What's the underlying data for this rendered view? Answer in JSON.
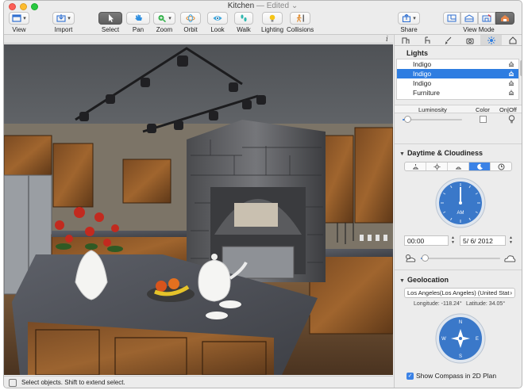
{
  "window": {
    "title": "Kitchen",
    "edited": " — Edited ⌄"
  },
  "toolbar": {
    "view": "View",
    "import": "Import",
    "select": "Select",
    "pan": "Pan",
    "zoom": "Zoom",
    "orbit": "Orbit",
    "look": "Look",
    "walk": "Walk",
    "lighting": "Lighting",
    "collisions": "Collisions",
    "share": "Share",
    "view_mode": "View Mode"
  },
  "status": {
    "text": "Select objects. Shift to extend select."
  },
  "panel": {
    "lights_title": "Lights",
    "lights": [
      {
        "name": "Indigo",
        "selected": false
      },
      {
        "name": "Indigo",
        "selected": true
      },
      {
        "name": "Indigo",
        "selected": false
      },
      {
        "name": "Furniture",
        "selected": false
      }
    ],
    "columns": {
      "luminosity": "Luminosity",
      "color": "Color",
      "onoff": "On|Off"
    },
    "luminosity_level": 0.08,
    "daytime_title": "Daytime & Cloudiness",
    "clock_label": "AM",
    "time": "00:00",
    "date": "5/  6/ 2012",
    "cloudiness_level": 0.05,
    "geolocation_title": "Geolocation",
    "location": "Los Angeles(Los Angeles) (United Stat",
    "longitude": "Longitude: -118.24°",
    "latitude": "Latitude: 34.05°",
    "compass_letters": {
      "n": "N",
      "e": "E",
      "s": "S",
      "w": "W"
    },
    "show_compass": "Show Compass in 2D Plan"
  },
  "colors": {
    "accent": "#3b82e6",
    "selection": "#2e7de1",
    "dial": "#3a78c9"
  }
}
